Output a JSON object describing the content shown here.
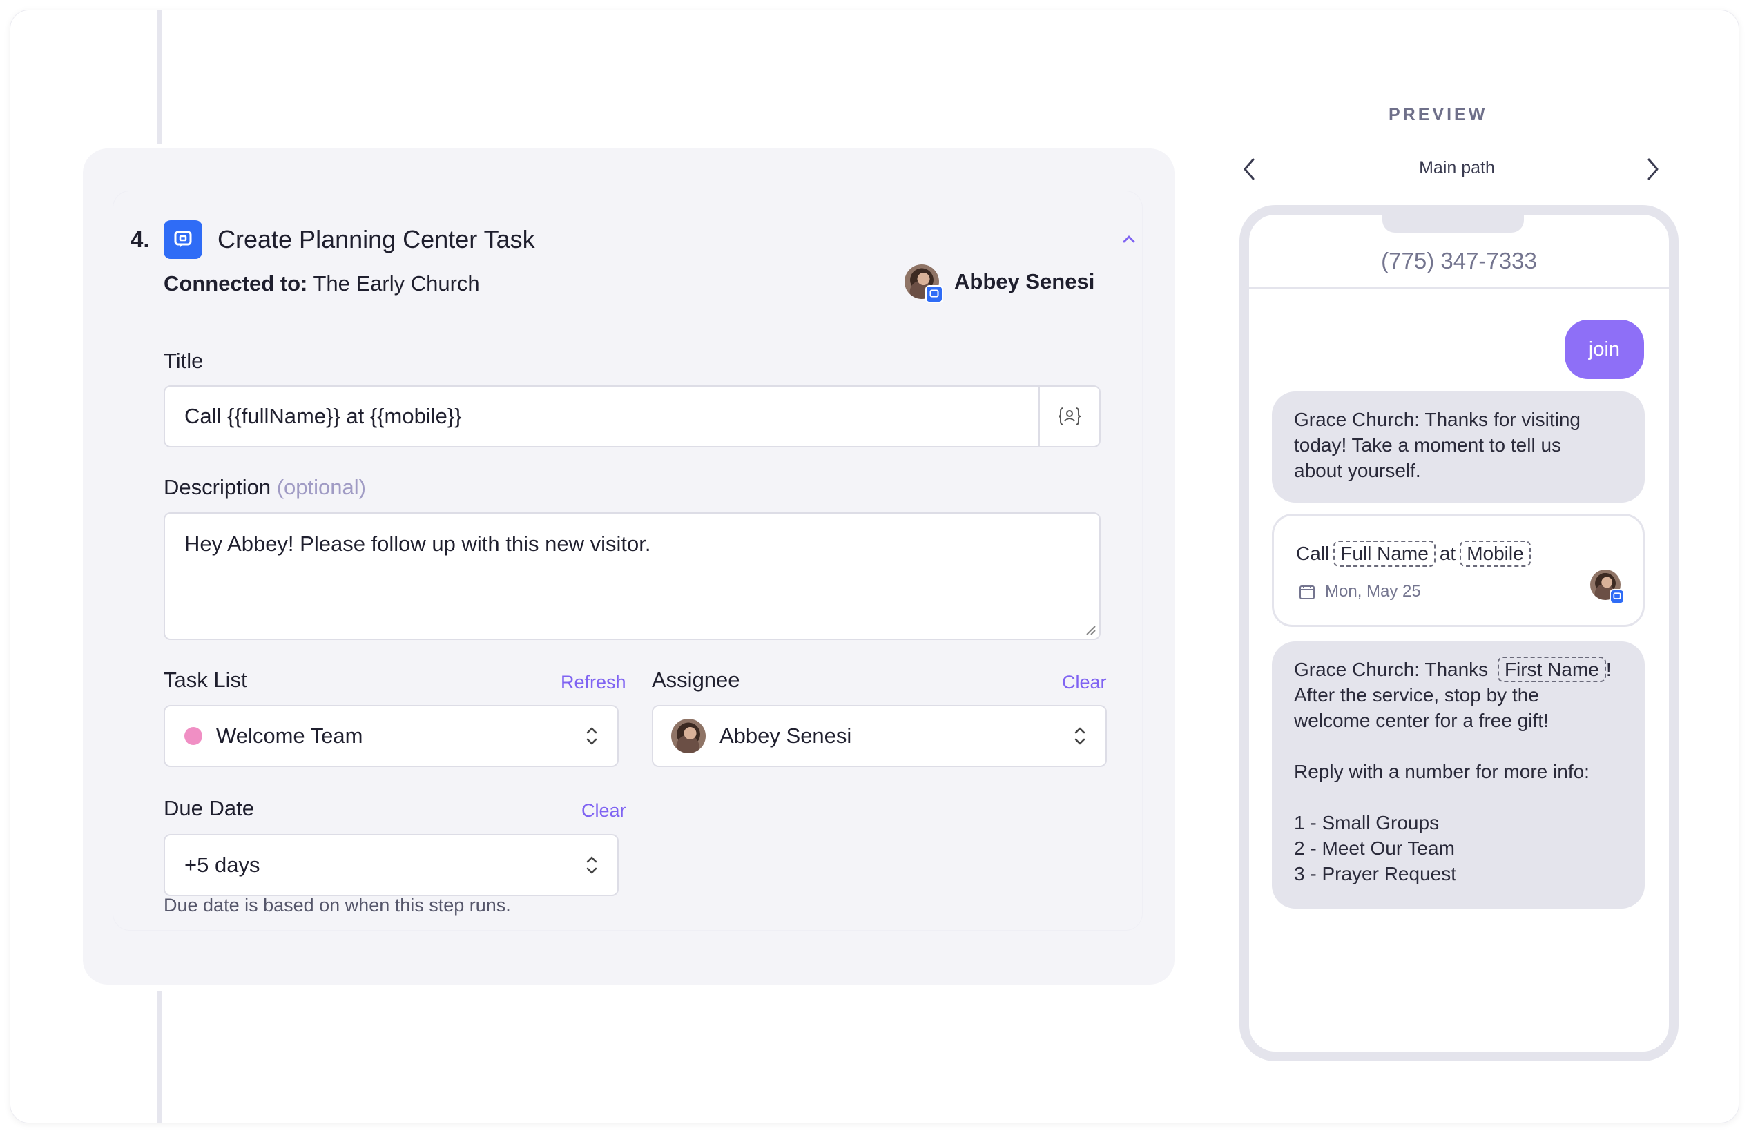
{
  "step": {
    "number": "4.",
    "title": "Create Planning Center Task",
    "connected_label": "Connected to:",
    "connected_value": "The Early Church",
    "owner_name": "Abbey Senesi"
  },
  "form": {
    "title_label": "Title",
    "title_value": "Call {{fullName}} at {{mobile}}",
    "variable_button": "{ }",
    "description_label": "Description",
    "description_optional": "(optional)",
    "description_value": "Hey Abbey! Please follow up with this new visitor.",
    "task_list_label": "Task List",
    "task_list_refresh": "Refresh",
    "task_list_value": "Welcome Team",
    "assignee_label": "Assignee",
    "assignee_clear": "Clear",
    "assignee_value": "Abbey Senesi",
    "due_date_label": "Due Date",
    "due_date_clear": "Clear",
    "due_date_value": "+5 days",
    "due_date_helper": "Due date is based on when this step runs."
  },
  "preview": {
    "label": "PREVIEW",
    "path": "Main path",
    "phone_number": "(775) 347-7333",
    "outgoing": "join",
    "message1": [
      "Grace Church: Thanks for visiting",
      "today! Take a moment to tell us",
      "about yourself."
    ],
    "task": {
      "call": "Call",
      "chip1": "Full Name",
      "at": "at",
      "chip2": "Mobile",
      "date": "Mon, May 25"
    },
    "message2": {
      "prefix": "Grace Church: Thanks",
      "chip": "First Name",
      "suffix": "!",
      "lines": [
        "After the service, stop by the",
        "welcome center for a free gift!",
        "",
        "Reply with a number for more info:",
        "",
        "1 - Small Groups",
        "2 - Meet Our Team",
        "3 - Prayer Request"
      ]
    }
  },
  "colors": {
    "accent": "#7f63f2",
    "bubble_out": "#8e6ff7",
    "brand_blue": "#2f6cf6",
    "task_list_dot": "#f08fc4"
  },
  "icons": {
    "app": "planning-center-icon",
    "collapse": "chevron-up-icon",
    "variable": "variable-icon",
    "select": "updown-chevron-icon",
    "prev": "chevron-left-icon",
    "next": "chevron-right-icon",
    "calendar": "calendar-icon"
  }
}
